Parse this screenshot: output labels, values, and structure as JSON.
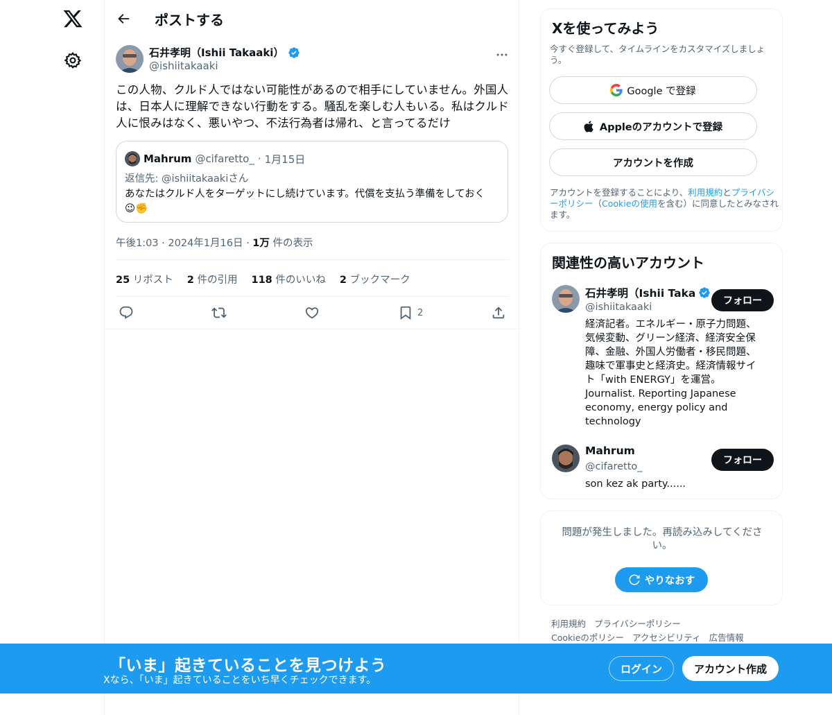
{
  "header": {
    "title": "ポストする"
  },
  "tweet": {
    "author_name": "石井孝明（Ishii Takaaki）",
    "author_handle": "@ishiitakaaki",
    "text": "この人物、クルド人ではない可能性があるので相手にしていません。外国人は、日本人に理解できない行動をする。騒乱を楽しむ人もいる。私はクルド人に恨みはなく、悪いやつ、不法行為者は帰れ、と言ってるだけ",
    "quote": {
      "name": "Mahrum",
      "handle": "@cifaretto_",
      "separator": "·",
      "date": "1月15日",
      "reply_to": "返信先: @ishiitakaakiさん",
      "text": "あなたはクルド人をターゲットにし続けています。代償を支払う準備をしておく",
      "emoji": "😉✊"
    },
    "meta": {
      "time": "午後1:03",
      "date": "2024年1月16日",
      "sep": "·",
      "views_count": "1万",
      "views_label": "件の表示"
    },
    "stats": {
      "reposts_count": "25",
      "reposts_label": "リポスト",
      "quotes_count": "2",
      "quotes_label": "件の引用",
      "likes_count": "118",
      "likes_label": "件のいいね",
      "bookmarks_count": "2",
      "bookmarks_label": "ブックマーク"
    },
    "actions": {
      "bookmark_count": "2"
    }
  },
  "signup": {
    "title": "Xを使ってみよう",
    "subtitle": "今すぐ登録して、タイムラインをカスタマイズしましょう。",
    "google_label": "Google で登録",
    "apple_label": "Appleのアカウントで登録",
    "create_label": "アカウントを作成",
    "terms_prefix": "アカウントを登録することにより、",
    "terms_link": "利用規約",
    "terms_and": "と",
    "privacy_link": "プライバシーポリシー",
    "terms_paren_open": "（",
    "cookie_link": "Cookieの使用",
    "terms_suffix": "を含む）に同意したとみなされます。"
  },
  "related": {
    "title": "関連性の高いアカウント",
    "accounts": [
      {
        "name": "石井孝明（Ishii Taka",
        "handle": "@ishiitakaaki",
        "bio": "経済記者。エネルギー・原子力問題、気候変動、グリーン経済、経済安全保障、金融、外国人労働者・移民問題、趣味で軍事史と経済史。経済情報サイト「with ENERGY」を運営。 Journalist. Reporting Japanese economy, energy policy and technology",
        "follow_label": "フォロー"
      },
      {
        "name": "Mahrum",
        "handle": "@cifaretto_",
        "bio": "son kez ak party......",
        "follow_label": "フォロー"
      }
    ]
  },
  "error": {
    "text": "問題が発生しました。再読み込みしてください。",
    "retry_label": "やりなおす"
  },
  "footer": {
    "links": [
      "利用規約",
      "プライバシーポリシー",
      "Cookieのポリシー",
      "アクセシビリティ",
      "広告情報"
    ]
  },
  "banner": {
    "title": "「いま」起きていることを見つけよう",
    "subtitle": "Xなら、「いま」起きていることをいち早くチェックできます。",
    "login_label": "ログイン",
    "signup_label": "アカウント作成"
  },
  "colors": {
    "accent": "#1d9bf0",
    "text": "#0f1419",
    "secondary": "#536471"
  }
}
